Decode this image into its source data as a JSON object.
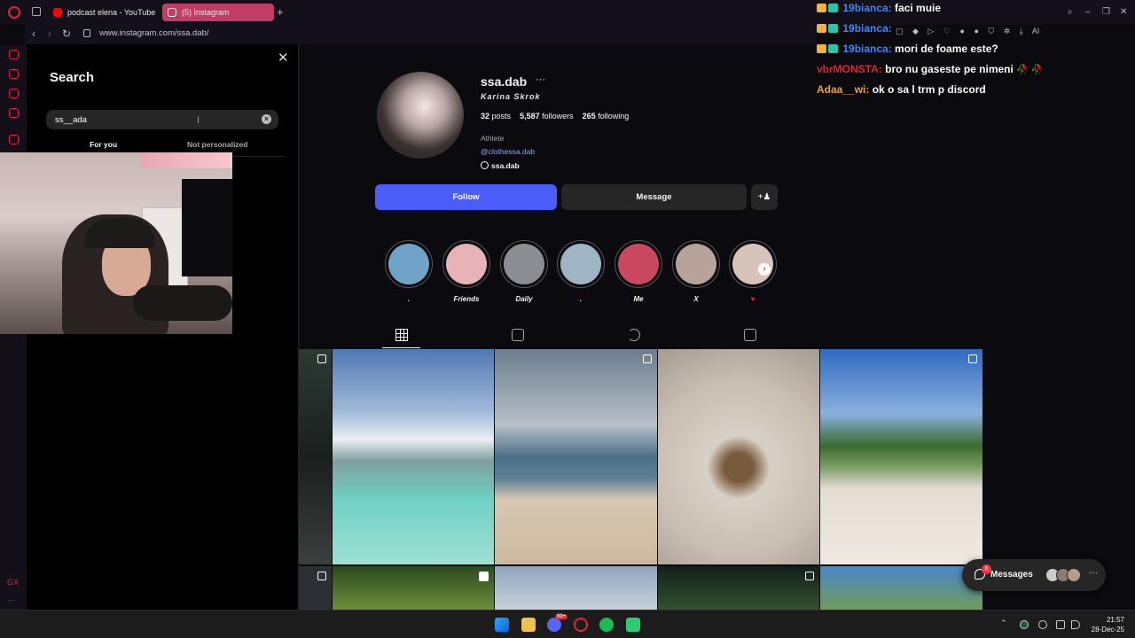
{
  "browser": {
    "tabs": [
      {
        "label": "podcast elena - YouTube"
      },
      {
        "label": "(5) Instagram"
      }
    ],
    "new_tab": "+",
    "url": "www.instagram.com/ssa.dab/",
    "ai_label": "AI",
    "sidebar_gx": "GX",
    "sidebar_more": "···"
  },
  "search": {
    "title": "Search",
    "value": "ss__ada",
    "clear": "×",
    "tab_for_you": "For you",
    "tab_not_personalized": "Not personalized"
  },
  "chat": [
    {
      "user": "19bianca:",
      "message": "faci muie",
      "color": "#3d8bff",
      "badges": true
    },
    {
      "user": "19bianca:",
      "message": "",
      "color": "#3d8bff",
      "badges": true
    },
    {
      "user": "19bianca:",
      "message": "mori de foame este?",
      "color": "#3d8bff",
      "badges": true
    },
    {
      "user": "vbrMONSTA:",
      "message": "bro nu gaseste pe nimeni",
      "color": "#e0243f",
      "badges": false,
      "emote": "🥀 🥀"
    },
    {
      "user": "Adaa__wi:",
      "message": "ok o sa l trm p discord",
      "color": "#f2a23c",
      "badges": false
    }
  ],
  "profile": {
    "username": "ssa.dab",
    "more": "···",
    "full_name": "Karina Skrok",
    "posts_count": "32",
    "posts_label": "posts",
    "followers_count": "5,587",
    "followers_label": "followers",
    "following_count": "265",
    "following_label": "following",
    "category": "Athlete",
    "bio_link": "@clothessa.dab",
    "threads_handle": "ssa.dab",
    "follow_label": "Follow",
    "message_label": "Message",
    "add_user_icon": "+♟"
  },
  "highlights": [
    {
      "label": ".",
      "color": "#6fa3c7"
    },
    {
      "label": "Friends",
      "color": "#e7b3b6"
    },
    {
      "label": "Daily",
      "color": "#8b8d93"
    },
    {
      "label": ".",
      "color": "#9fb4c5"
    },
    {
      "label": "Me",
      "color": "#c9485f"
    },
    {
      "label": "X",
      "color": "#b8a39a"
    },
    {
      "label": "♥",
      "color": "#d8c2b9"
    }
  ],
  "highlights_next": "›",
  "messages": {
    "label": "Messages",
    "badge": "5",
    "more": "···"
  },
  "taskbar": {
    "time": "21:57",
    "date": "28-Dec-25",
    "discord_badge": "99+"
  },
  "colors": {
    "accent_follow": "#4a5df9",
    "opera_red": "#e0243f",
    "tab_active": "#c23d63"
  }
}
